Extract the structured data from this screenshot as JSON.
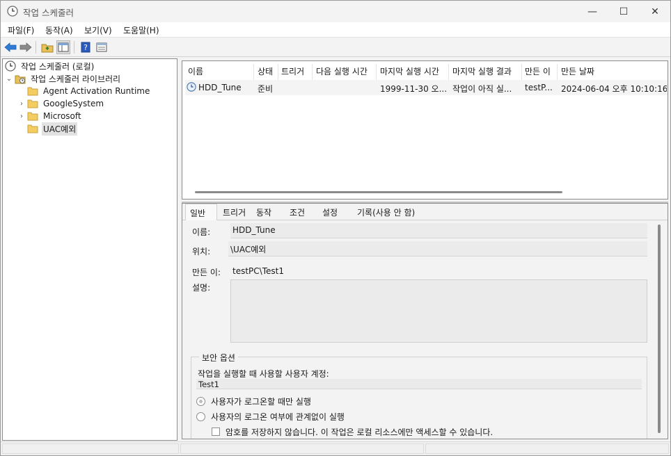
{
  "window": {
    "title": "작업 스케줄러",
    "controls": {
      "minimize": "—",
      "maximize": "☐",
      "close": "✕"
    }
  },
  "menu": [
    "파일(F)",
    "동작(A)",
    "보기(V)",
    "도움말(H)"
  ],
  "toolbar": {
    "icons": [
      "back-arrow-icon",
      "forward-arrow-icon",
      "folder-up-icon",
      "show-hide-tree-icon",
      "help-icon",
      "properties-icon"
    ]
  },
  "tree": {
    "root": "작업 스케줄러 (로컬)",
    "library": "작업 스케줄러 라이브러리",
    "folders": [
      {
        "label": "Agent Activation Runtime",
        "expandable": false,
        "selected": false
      },
      {
        "label": "GoogleSystem",
        "expandable": true,
        "selected": false
      },
      {
        "label": "Microsoft",
        "expandable": true,
        "selected": false
      },
      {
        "label": "UAC예외",
        "expandable": false,
        "selected": true
      }
    ]
  },
  "task_list": {
    "columns": [
      "이름",
      "상태",
      "트리거",
      "다음 실행 시간",
      "마지막 실행 시간",
      "마지막 실행 결과",
      "만든 이",
      "만든 날짜"
    ],
    "rows": [
      {
        "name": "HDD_Tune",
        "status": "준비",
        "trigger": "",
        "next_run": "",
        "last_run": "1999-11-30 오...",
        "last_result": "작업이 아직 실...",
        "author": "testP...",
        "created": "2024-06-04 오후 10:10:16"
      }
    ]
  },
  "tabs": [
    "일반",
    "트리거",
    "동작",
    "조건",
    "설정",
    "기록(사용 안 함)"
  ],
  "active_tab": "일반",
  "general": {
    "name_label": "이름:",
    "name_value": "HDD_Tune",
    "location_label": "위치:",
    "location_value": "\\UAC예외",
    "author_label": "만든 이:",
    "author_value": "testPC\\Test1",
    "description_label": "설명:",
    "description_value": "",
    "security_group": "보안 옵션",
    "account_label": "작업을 실행할 때 사용할 사용자 계정:",
    "account_value": "Test1",
    "radio_logged_on": "사용자가 로그온할 때만 실행",
    "radio_any": "사용자의 로그온 여부에 관계없이 실행",
    "checkbox_no_password": "암호를 저장하지 않습니다. 이 작업은 로컬 리소스에만 액세스할 수 있습니다."
  }
}
